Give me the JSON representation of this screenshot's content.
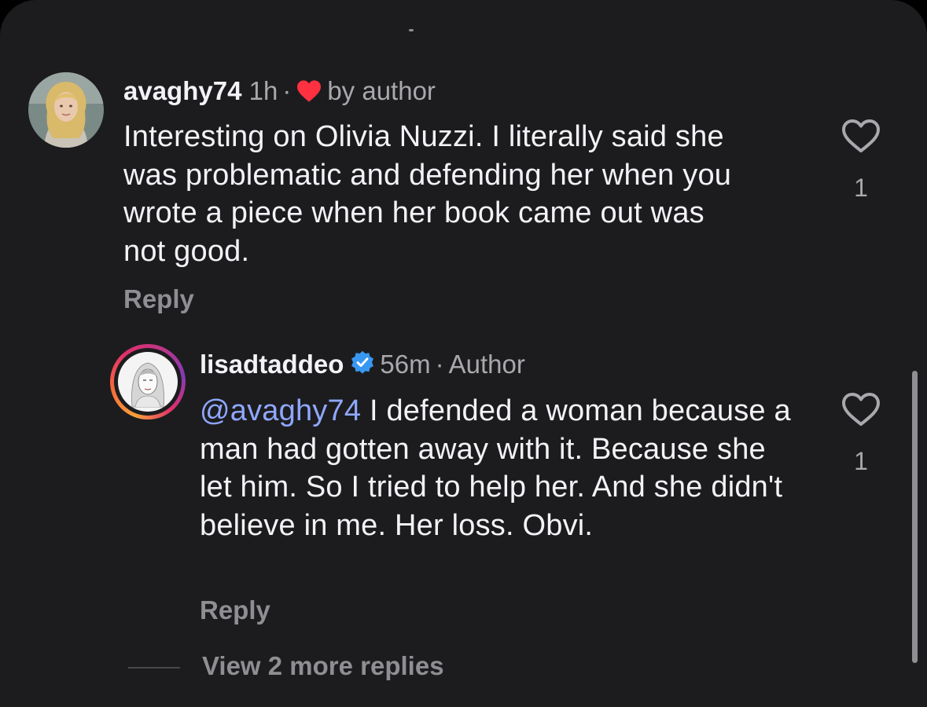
{
  "comments": [
    {
      "username": "avaghy74",
      "time": "1h",
      "separator": "·",
      "badge": "by author",
      "text": "Interesting on Olivia Nuzzi. I literally said she was problematic and defending her when you wrote a piece when her book came out was not good.",
      "reply_label": "Reply",
      "likes": "1",
      "liked_by_author": true,
      "avatar_icon": "avatar-photo"
    },
    {
      "username": "lisadtaddeo",
      "verified": true,
      "time": "56m",
      "separator": "·",
      "badge": "Author",
      "mention": "@avaghy74",
      "text": " I defended a woman because a man had gotten away with it. Because she let him. So I tried to help her. And she didn't believe in me. Her loss. Obvi.",
      "reply_label": "Reply",
      "likes": "1",
      "has_story_ring": true,
      "avatar_icon": "avatar-sketch"
    }
  ],
  "view_more_label": "View 2 more replies",
  "colors": {
    "background": "#1c1c1e",
    "primary_text": "#f2f2f7",
    "secondary_text": "#a8a8ad",
    "mention": "#8fa7ff",
    "heart_red": "#ff3040",
    "verified_blue": "#3897f0"
  },
  "icons": {
    "like": "heart-outline-icon",
    "liked_by_author": "heart-filled-icon",
    "verified": "verified-badge-icon"
  }
}
